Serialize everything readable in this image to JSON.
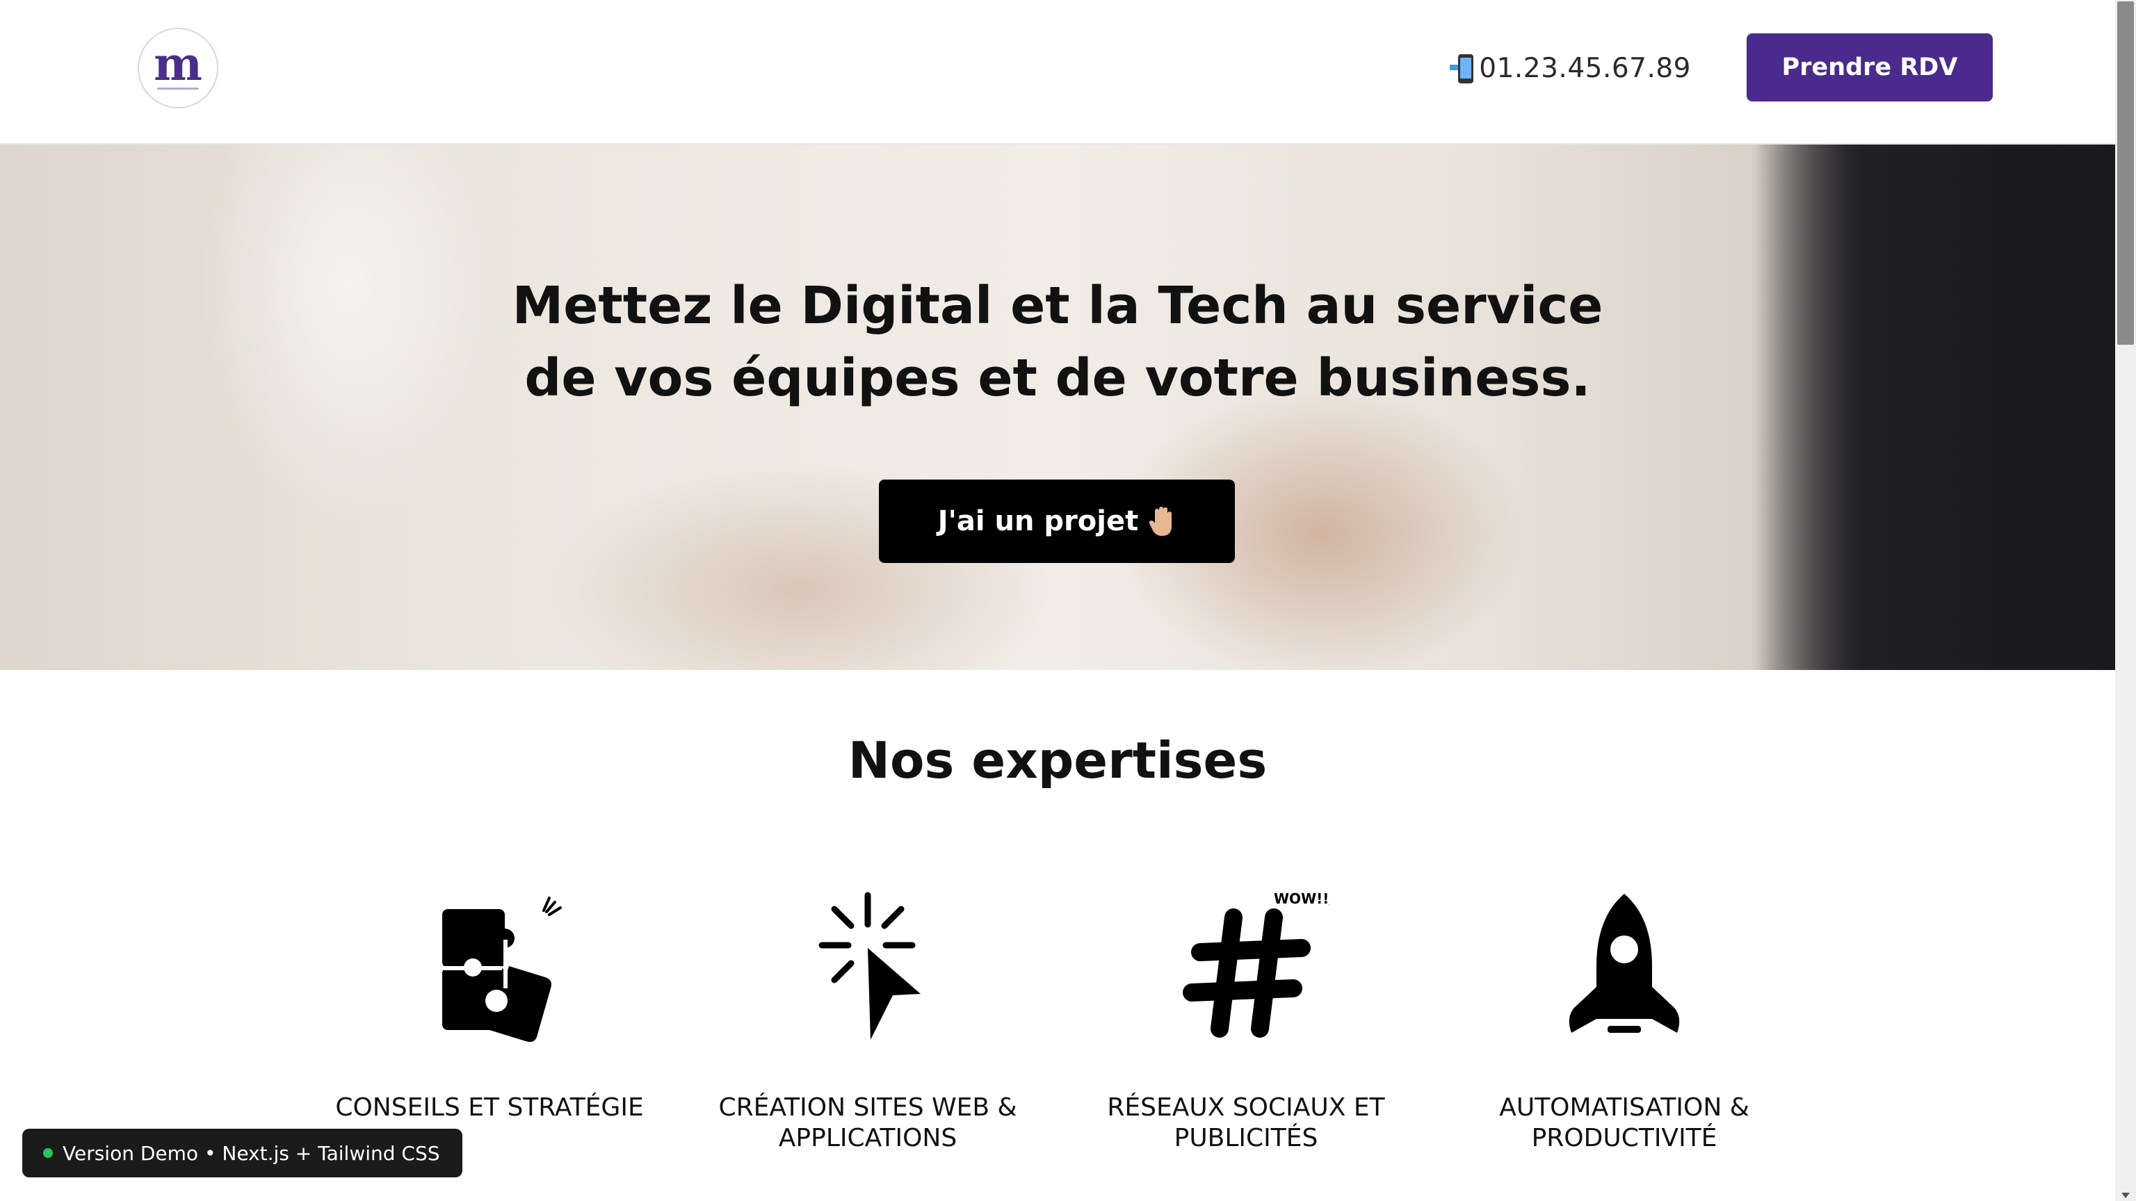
{
  "header": {
    "logo_letter": "m",
    "phone": "01.23.45.67.89",
    "cta_label": "Prendre RDV"
  },
  "hero": {
    "title_line1": "Mettez le Digital et la Tech au service",
    "title_line2": "de vos équipes et de votre business.",
    "button_label": "J'ai un projet"
  },
  "expertises": {
    "title": "Nos expertises",
    "items": [
      {
        "icon": "puzzle-icon",
        "label_line1": "CONSEILS ET STRATÉGIE",
        "label_line2": ""
      },
      {
        "icon": "cursor-click-icon",
        "label_line1": "CRÉATION SITES WEB &",
        "label_line2": "APPLICATIONS"
      },
      {
        "icon": "hashtag-icon",
        "label_line1": "RÉSEAUX SOCIAUX ET",
        "label_line2": "PUBLICITÉS",
        "icon_text": "WOW!!/"
      },
      {
        "icon": "rocket-icon",
        "label_line1": "AUTOMATISATION &",
        "label_line2": "PRODUCTIVITÉ"
      }
    ]
  },
  "demo_badge": {
    "label": "Version Demo • Next.js + Tailwind CSS",
    "dot_color": "#22c55e"
  },
  "colors": {
    "brand": "#4a2a8c",
    "cta_dark": "#000000"
  }
}
